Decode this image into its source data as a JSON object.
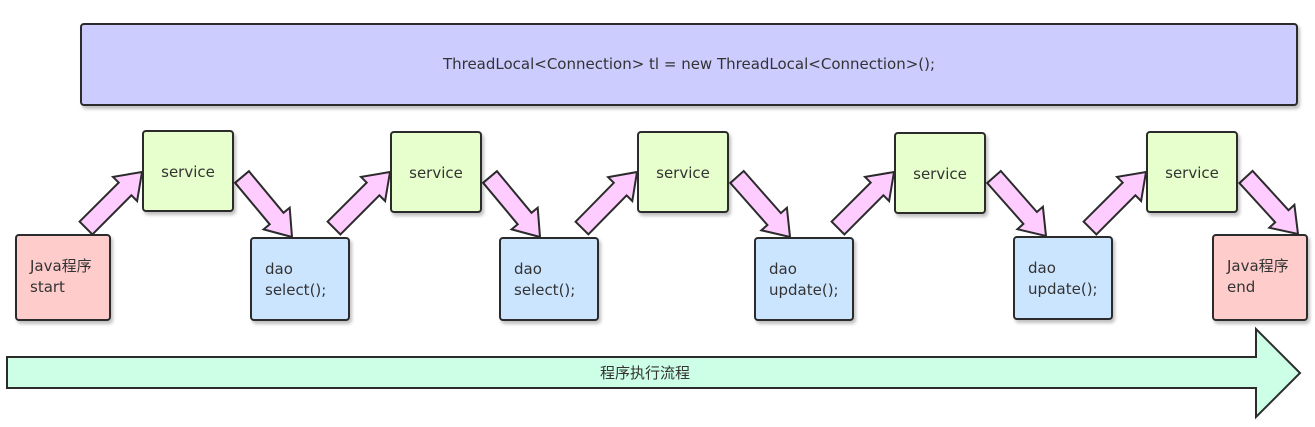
{
  "banner": {
    "text": "ThreadLocal<Connection> tl = new ThreadLocal<Connection>();"
  },
  "start_node": {
    "line1": "Java程序",
    "line2": "start"
  },
  "end_node": {
    "line1": "Java程序",
    "line2": "end"
  },
  "services": [
    {
      "label": "service"
    },
    {
      "label": "service"
    },
    {
      "label": "service"
    },
    {
      "label": "service"
    },
    {
      "label": "service"
    }
  ],
  "daos": [
    {
      "line1": "dao",
      "line2": "select();"
    },
    {
      "line1": "dao",
      "line2": "select();"
    },
    {
      "line1": "dao",
      "line2": "update();"
    },
    {
      "line1": "dao",
      "line2": "update();"
    }
  ],
  "flow": {
    "label": "程序执行流程"
  },
  "colors": {
    "banner": "#ccccff",
    "service": "#e6ffcc",
    "dao": "#cce5ff",
    "java": "#ffcccc",
    "connector_arrow": "#ffccff",
    "flow_arrow": "#ccffe6"
  }
}
